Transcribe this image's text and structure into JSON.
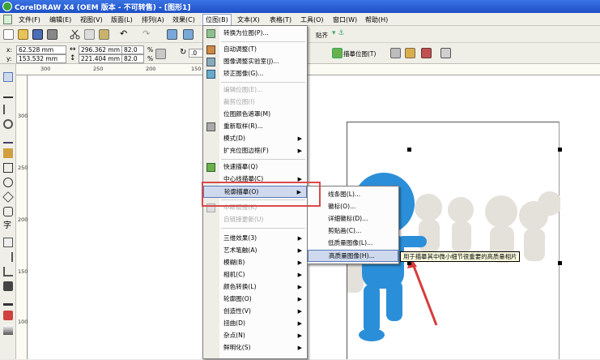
{
  "window": {
    "title": "CorelDRAW X4 (OEM 版本 - 不可转售) - [图形1]"
  },
  "menubar": {
    "items": [
      "文件(F)",
      "编辑(E)",
      "视图(V)",
      "版面(L)",
      "排列(A)",
      "效果(C)",
      "位图(B)",
      "文本(X)",
      "表格(T)",
      "工具(O)",
      "窗口(W)",
      "帮助(H)"
    ]
  },
  "toolbar": {
    "paste_label": "贴齐"
  },
  "propertybar": {
    "x_label": "x:",
    "x_value": "62.528 mm",
    "y_label": "y:",
    "y_value": "153.532 mm",
    "w_value": "296.362 mm",
    "h_value": "221.404 mm",
    "scale_x": "82.0",
    "scale_y": "82.0",
    "pct": "%",
    "rot_value": ".0",
    "trace_label": "描摹位图(T)"
  },
  "ruler_h": [
    "300",
    "250",
    "200",
    "150"
  ],
  "ruler_v": [
    "300",
    "250",
    "200",
    "150",
    "100"
  ],
  "bitmap_menu": {
    "items": [
      {
        "label": "转换为位图(P)...",
        "disabled": false,
        "arrow": false
      },
      {
        "label": "自动调整(T)",
        "disabled": false,
        "arrow": false
      },
      {
        "label": "图像调整实验室(J)...",
        "disabled": false,
        "arrow": false
      },
      {
        "label": "矫正图像(G)...",
        "disabled": false,
        "arrow": false
      },
      {
        "label": "编辑位图(E)...",
        "disabled": true,
        "arrow": false
      },
      {
        "label": "裁剪位图(I)",
        "disabled": true,
        "arrow": false
      },
      {
        "label": "位图颜色遮罩(M)",
        "disabled": false,
        "arrow": false
      },
      {
        "label": "重新取样(R)...",
        "disabled": false,
        "arrow": false
      },
      {
        "label": "模式(D)",
        "disabled": false,
        "arrow": true
      },
      {
        "label": "扩充位图边框(F)",
        "disabled": false,
        "arrow": true
      },
      {
        "label": "快速描摹(Q)",
        "disabled": false,
        "arrow": false
      },
      {
        "label": "中心线描摹(C)",
        "disabled": false,
        "arrow": true
      },
      {
        "label": "轮廓描摹(O)",
        "disabled": false,
        "arrow": true
      },
      {
        "label": "中断链接(K)",
        "disabled": true,
        "arrow": false
      },
      {
        "label": "自链接更新(U)",
        "disabled": true,
        "arrow": false
      },
      {
        "label": "三维效果(3)",
        "disabled": false,
        "arrow": true
      },
      {
        "label": "艺术笔触(A)",
        "disabled": false,
        "arrow": true
      },
      {
        "label": "模糊(B)",
        "disabled": false,
        "arrow": true
      },
      {
        "label": "相机(C)",
        "disabled": false,
        "arrow": true
      },
      {
        "label": "颜色转换(L)",
        "disabled": false,
        "arrow": true
      },
      {
        "label": "轮廓图(O)",
        "disabled": false,
        "arrow": true
      },
      {
        "label": "创造性(V)",
        "disabled": false,
        "arrow": true
      },
      {
        "label": "扭曲(D)",
        "disabled": false,
        "arrow": true
      },
      {
        "label": "杂点(N)",
        "disabled": false,
        "arrow": true
      },
      {
        "label": "鲜明化(S)",
        "disabled": false,
        "arrow": true
      }
    ]
  },
  "outline_submenu": {
    "items": [
      "线条图(L)...",
      "徽标(O)...",
      "详细徽标(D)...",
      "剪贴画(C)...",
      "低质量图像(L)...",
      "高质量图像(H)..."
    ]
  },
  "tooltip": "用于描摹其中微小细节很重要的高质量相片"
}
